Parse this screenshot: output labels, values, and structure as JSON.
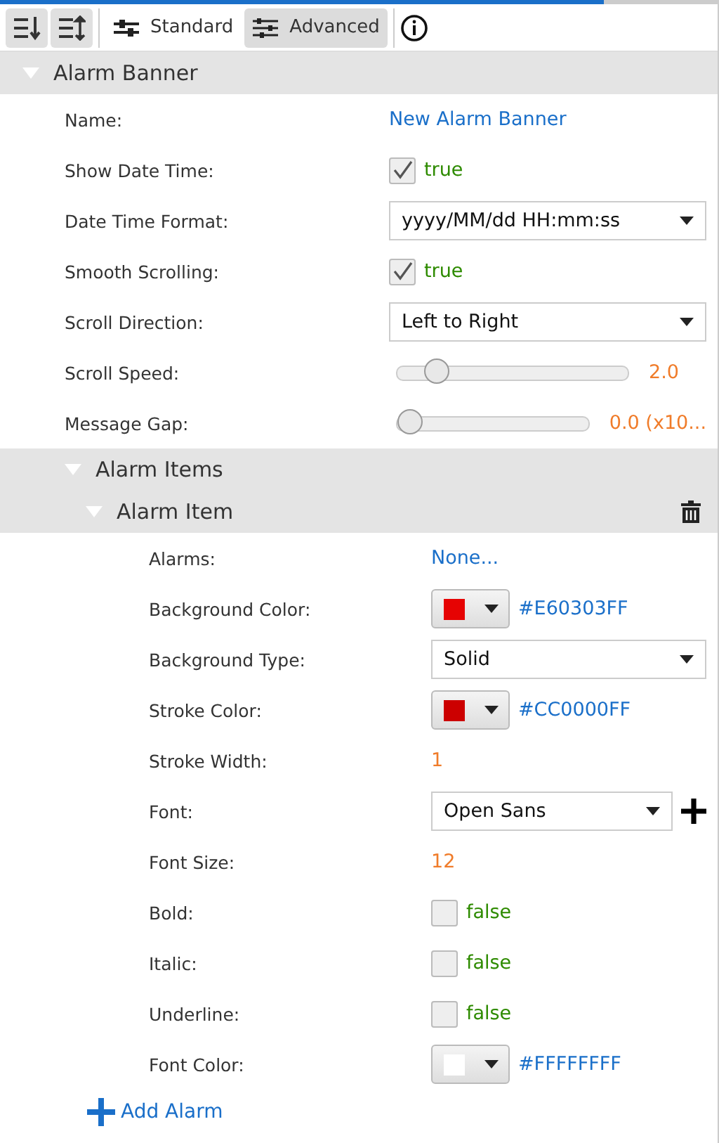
{
  "toolbar": {
    "sort_buttons": [
      {
        "kind": "sort-down",
        "selected": true
      },
      {
        "kind": "sort-up",
        "selected": true
      }
    ],
    "modes": [
      {
        "label": "Standard",
        "selected": false
      },
      {
        "label": "Advanced",
        "selected": true
      }
    ]
  },
  "sections": [
    {
      "title": "Alarm Banner",
      "expanded": true,
      "rows": [
        {
          "label": "Name:",
          "kind": "link",
          "value": "New Alarm Banner"
        },
        {
          "label": "Show Date Time:",
          "kind": "check",
          "checked": true,
          "value": "true"
        },
        {
          "label": "Date Time Format:",
          "kind": "select",
          "value": "yyyy/MM/dd HH:mm:ss"
        },
        {
          "label": "Smooth Scrolling:",
          "kind": "check",
          "checked": true,
          "value": "true"
        },
        {
          "label": "Scroll Direction:",
          "kind": "select",
          "value": "Left to Right"
        },
        {
          "label": "Scroll Speed:",
          "kind": "slider",
          "level": 0.13,
          "value": "2.0"
        },
        {
          "label": "Message Gap:",
          "kind": "slider",
          "level": 0,
          "value": "0.0 (x10..."
        }
      ],
      "children": [
        {
          "title": "Alarm Items",
          "expanded": true,
          "children": [
            {
              "title": "Alarm Item",
              "expanded": true,
              "deletable": true,
              "rows": [
                {
                  "label": "Alarms:",
                  "kind": "link",
                  "value": "None..."
                },
                {
                  "label": "Background Color:",
                  "kind": "color",
                  "color": "#e60303",
                  "value": "#E60303FF"
                },
                {
                  "label": "Background Type:",
                  "kind": "select",
                  "value": "Solid"
                },
                {
                  "label": "Stroke Color:",
                  "kind": "color",
                  "color": "#cc0000",
                  "value": "#CC0000FF"
                },
                {
                  "label": "Stroke Width:",
                  "kind": "number",
                  "value": "1"
                },
                {
                  "label": "Font:",
                  "kind": "select_add",
                  "value": "Open Sans"
                },
                {
                  "label": "Font Size:",
                  "kind": "number",
                  "value": "12"
                },
                {
                  "label": "Bold:",
                  "kind": "check",
                  "checked": false,
                  "value": "false"
                },
                {
                  "label": "Italic:",
                  "kind": "check",
                  "checked": false,
                  "value": "false"
                },
                {
                  "label": "Underline:",
                  "kind": "check",
                  "checked": false,
                  "value": "false"
                },
                {
                  "label": "Font Color:",
                  "kind": "color",
                  "color": "#ffffff",
                  "value": "#FFFFFFFF"
                }
              ]
            }
          ]
        }
      ]
    }
  ],
  "add_link": "Add Alarm"
}
